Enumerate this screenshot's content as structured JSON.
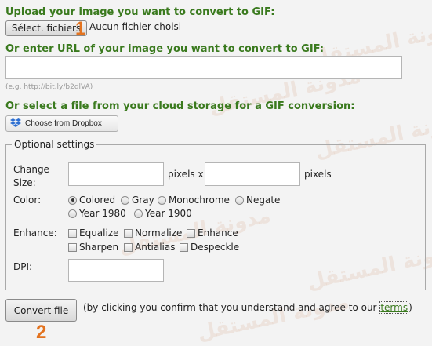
{
  "watermark": {
    "text": "مدونة المستقل"
  },
  "upload": {
    "heading": "Upload your image you want to convert to GIF:",
    "choose_button": "Sélect. fichiers",
    "file_status": "Aucun fichier choisi"
  },
  "url": {
    "heading": "Or enter URL of your image you want to convert to GIF:",
    "value": "",
    "hint": "(e.g. http://bit.ly/b2dlVA)"
  },
  "cloud": {
    "heading": "Or select a file from your cloud storage for a GIF conversion:",
    "dropbox_button": "Choose from Dropbox"
  },
  "annotations": {
    "step1": "1",
    "step2": "2"
  },
  "optional": {
    "legend": "Optional settings",
    "change_size_label": "Change Size:",
    "width_value": "",
    "height_value": "",
    "pixels_x": "pixels x",
    "pixels": "pixels",
    "color_label": "Color:",
    "color_options": [
      "Colored",
      "Gray",
      "Monochrome",
      "Negate",
      "Year 1980",
      "Year 1900"
    ],
    "color_selected": "Colored",
    "enhance_label": "Enhance:",
    "enhance_options": [
      "Equalize",
      "Normalize",
      "Enhance",
      "Sharpen",
      "Antialias",
      "Despeckle"
    ],
    "dpi_label": "DPI:",
    "dpi_value": ""
  },
  "convert": {
    "button": "Convert file",
    "consent_before": "(by clicking you confirm that you understand and agree to our ",
    "terms_link": "terms",
    "consent_after": ")"
  },
  "colors": {
    "heading_green": "#3a7a1e",
    "annotation_orange": "#e3731f",
    "dropbox_blue": "#2d6fd2"
  }
}
